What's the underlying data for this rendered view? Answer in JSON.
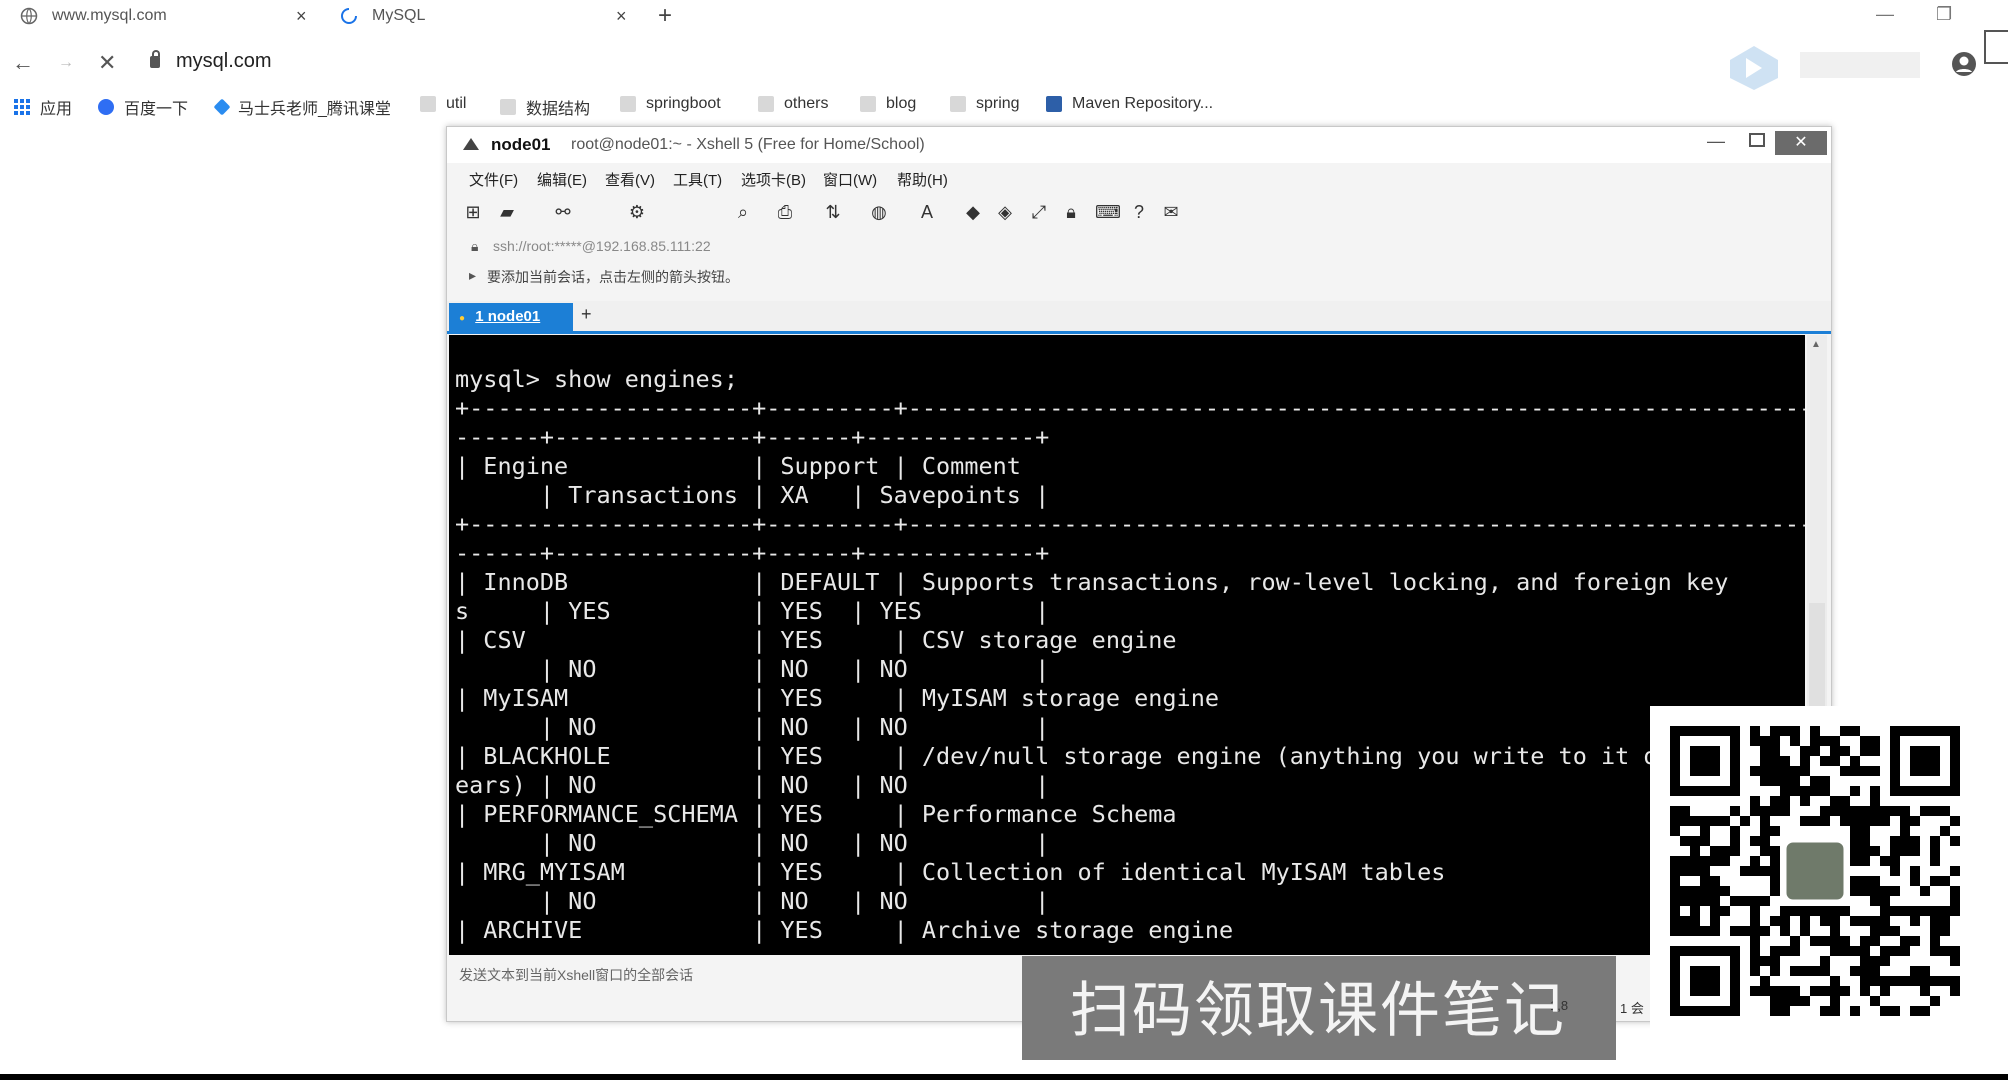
{
  "browser": {
    "tabs": [
      {
        "title": "www.mysql.com",
        "close": "×"
      },
      {
        "title": "MySQL",
        "close": "×"
      }
    ],
    "new_tab": "+",
    "window": {
      "minimize": "—",
      "restore": "❐"
    },
    "nav": {
      "back": "←",
      "forward": "→",
      "stop": "✕"
    },
    "address": "mysql.com",
    "bookmarks": [
      "应用",
      "百度一下",
      "马士兵老师_腾讯课堂",
      "util",
      "数据结构",
      "springboot",
      "others",
      "blog",
      "spring",
      "Maven Repository..."
    ]
  },
  "xshell": {
    "host": "node01",
    "title_sub": "root@node01:~ - Xshell 5 (Free for Home/School)",
    "controls": {
      "minimize": "—",
      "close": "✕"
    },
    "menu": [
      "文件(F)",
      "编辑(E)",
      "查看(V)",
      "工具(T)",
      "选项卡(B)",
      "窗口(W)",
      "帮助(H)"
    ],
    "session_url": "ssh://root:*****@192.168.85.111:22",
    "hint": "要添加当前会话，点击左侧的箭头按钮。",
    "tab_label": "1 node01",
    "tab_add": "+",
    "status_text": "发送文本到当前Xshell窗口的全部会话",
    "status_right": [
      "1,8",
      "1 会"
    ],
    "terminal_lines": [
      "mysql> show engines;",
      "+--------------------+---------+----------------------------------------------------------------",
      "------+--------------+------+------------+",
      "| Engine             | Support | Comment",
      "      | Transactions | XA   | Savepoints |",
      "+--------------------+---------+----------------------------------------------------------------",
      "------+--------------+------+------------+",
      "| InnoDB             | DEFAULT | Supports transactions, row-level locking, and foreign key",
      "s     | YES          | YES  | YES        |",
      "| CSV                | YES     | CSV storage engine",
      "      | NO           | NO   | NO         |",
      "| MyISAM             | YES     | MyISAM storage engine",
      "      | NO           | NO   | NO         |",
      "| BLACKHOLE          | YES     | /dev/null storage engine (anything you write to it disapp",
      "ears) | NO           | NO   | NO         |",
      "| PERFORMANCE_SCHEMA | YES     | Performance Schema",
      "      | NO           | NO   | NO         |",
      "| MRG_MYISAM         | YES     | Collection of identical MyISAM tables",
      "      | NO           | NO   | NO         |",
      "| ARCHIVE            | YES     | Archive storage engine"
    ]
  },
  "overlay": {
    "banner": "扫码领取课件笔记"
  }
}
